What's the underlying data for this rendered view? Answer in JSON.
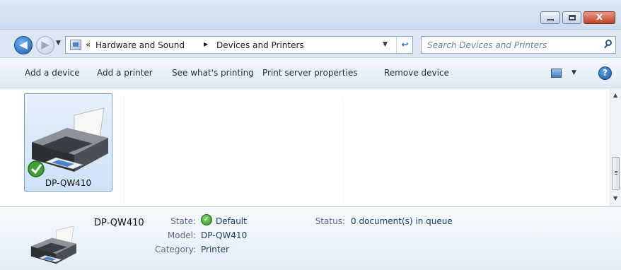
{
  "titlebar": {
    "minimize_icon": "minimize-icon",
    "maximize_icon": "maximize-icon",
    "close_label": "x"
  },
  "nav": {
    "back_glyph": "◀",
    "forward_glyph": "▶",
    "recent_glyph": "▼",
    "overflow": "«",
    "breadcrumb": [
      "Hardware and Sound",
      "Devices and Printers"
    ],
    "separator": "▶",
    "dropdown_glyph": "▼",
    "refresh_glyph": "↩"
  },
  "search": {
    "placeholder": "Search Devices and Printers"
  },
  "commands": [
    "Add a device",
    "Add a printer",
    "See what's printing",
    "Print server properties",
    "Remove device"
  ],
  "commandbar": {
    "view_dropdown_glyph": "▼",
    "help_label": "?"
  },
  "device": {
    "name": "DP-QW410"
  },
  "scrollbar": {
    "up_glyph": "▲",
    "down_glyph": "▼"
  },
  "details": {
    "name": "DP-QW410",
    "state_label": "State:",
    "state_icon_glyph": "✓",
    "state_value": "Default",
    "model_label": "Model:",
    "model_value": "DP-QW410",
    "category_label": "Category:",
    "category_value": "Printer",
    "status_label": "Status:",
    "status_value": "0 document(s) in queue"
  },
  "colors": {
    "accent": "#1f5aa8",
    "selection": "#cde2f7",
    "close": "#c2422a",
    "ok": "#2e8f24"
  }
}
